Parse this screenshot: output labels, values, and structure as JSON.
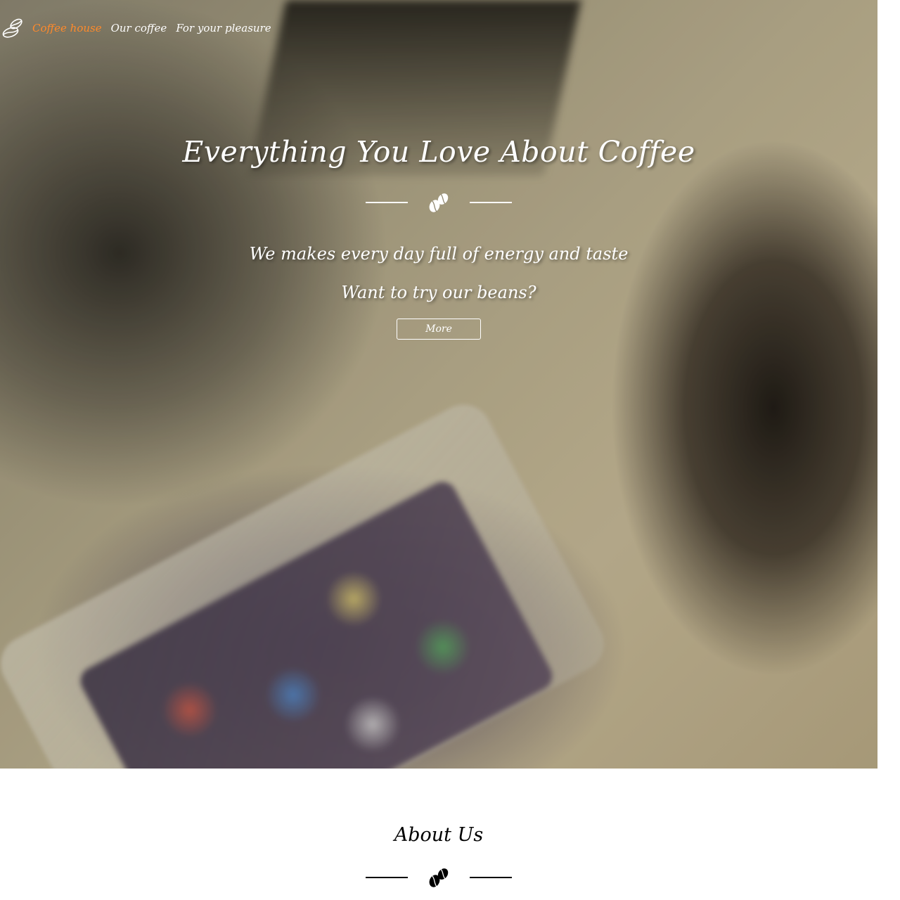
{
  "nav": {
    "logo_icon": "coffee-beans-outline-icon",
    "links": [
      {
        "label": "Coffee house",
        "active": true
      },
      {
        "label": "Our coffee",
        "active": false
      },
      {
        "label": "For your pleasure",
        "active": false
      }
    ],
    "active_color": "#ff8a2b"
  },
  "hero": {
    "title": "Everything You Love About Coffee",
    "divider_icon": "coffee-beans-icon",
    "subtitle_1": "We makes every day full of energy and taste",
    "subtitle_2": "Want to try our beans?",
    "button_label": "More"
  },
  "about": {
    "title": "About Us",
    "divider_icon": "coffee-beans-icon"
  }
}
